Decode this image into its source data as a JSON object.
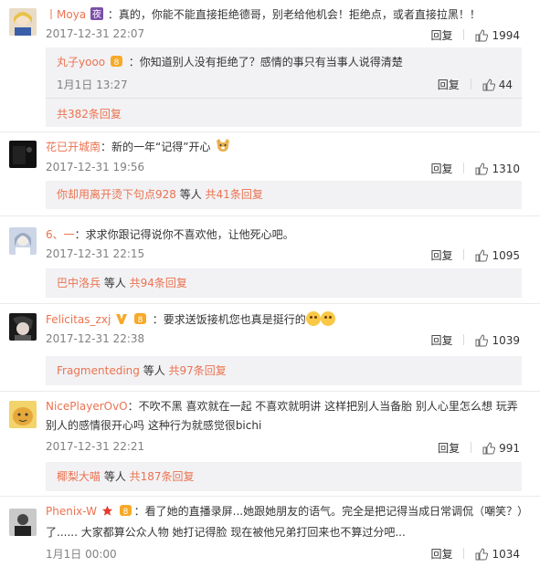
{
  "comments": [
    {
      "user": "丨Moya",
      "text": "：真的，你能不能直接拒绝德哥，别老给他机会！拒绝点，或者直接拉黑！！",
      "time": "2017-12-31 22:07",
      "reply": "回复",
      "likes": "1994",
      "sub_user": "丸子yooo",
      "sub_text": "：你知道别人没有拒绝了？感情的事只有当事人说得清楚",
      "sub_time": "1月1日 13:27",
      "sub_reply": "回复",
      "sub_likes": "44",
      "more": "共382条回复"
    },
    {
      "user": "花已开城南",
      "text": "：新的一年“记得”开心",
      "time": "2017-12-31 19:56",
      "reply": "回复",
      "likes": "1310",
      "reply_user": "你却用离开烫下句点928",
      "reply_mid": " 等人 ",
      "reply_count": "共41条回复"
    },
    {
      "user": "6、一",
      "text": "：求求你跟记得说你不喜欢他，让他死心吧。",
      "time": "2017-12-31 22:15",
      "reply": "回复",
      "likes": "1095",
      "reply_user": "巴中洛兵",
      "reply_mid": " 等人 ",
      "reply_count": "共94条回复"
    },
    {
      "user": "Felicitas_zxj",
      "text": "：要求送饭接机您也真是挺行的",
      "time": "2017-12-31 22:38",
      "reply": "回复",
      "likes": "1039",
      "reply_user": "Fragmenteding",
      "reply_mid": " 等人 ",
      "reply_count": "共97条回复"
    },
    {
      "user": "NicePlayerOvO",
      "text": "：不吹不黑 喜欢就在一起 不喜欢就明讲 这样把别人当备胎 别人心里怎么想 玩弄别人的感情很开心吗 这种行为就感觉很bichi",
      "time": "2017-12-31 22:21",
      "reply": "回复",
      "likes": "991",
      "reply_user": "椰梨大喵",
      "reply_mid": " 等人 ",
      "reply_count": "共187条回复"
    },
    {
      "user": "Phenix-W",
      "text": "：看了她的直播录屏...她跟她朋友的语气。完全是把记得当成日常调侃（嘲笑？）了...... 大家都算公众人物  她打记得脸 现在被他兄弟打回来也不算过分吧...",
      "time": "1月1日 00:00",
      "reply": "回复",
      "likes": "1034"
    }
  ],
  "colors": {
    "link": "#eb7350",
    "meta": "#808080",
    "subbox": "#f2f2f5"
  }
}
